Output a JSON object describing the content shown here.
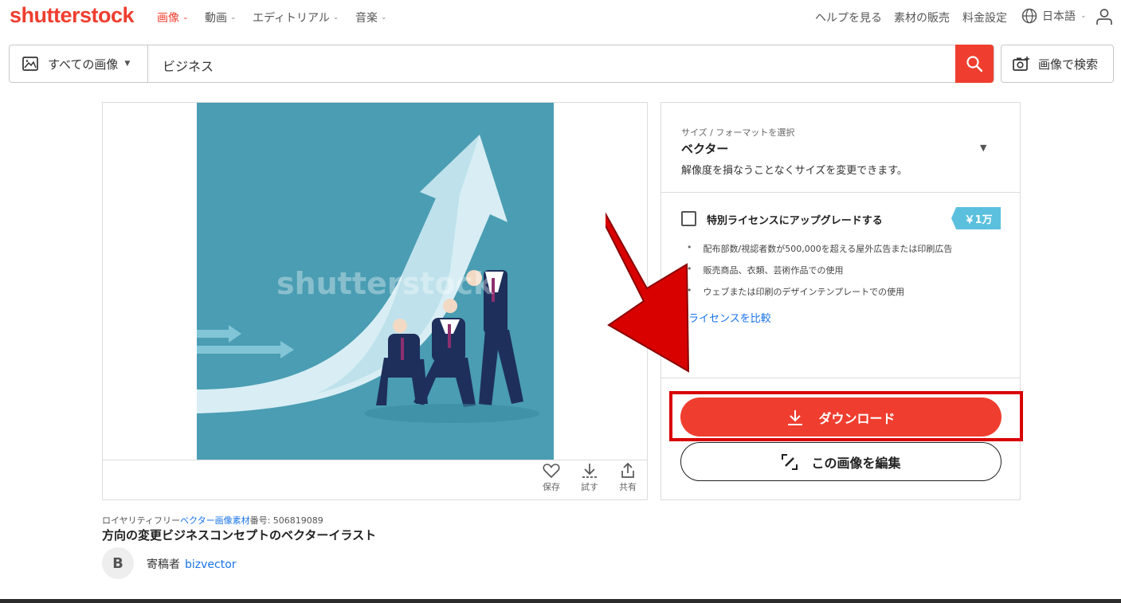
{
  "brand": {
    "logo_text": "shutterstock",
    "accent": "#ef3e2f"
  },
  "nav": {
    "items": [
      {
        "label": "画像",
        "active": true
      },
      {
        "label": "動画",
        "active": false
      },
      {
        "label": "エディトリアル",
        "active": false
      },
      {
        "label": "音楽",
        "active": false
      }
    ],
    "util": {
      "help": "ヘルプを見る",
      "sell": "素材の販売",
      "pricing": "料金設定",
      "language": "日本語"
    }
  },
  "search": {
    "scope": "すべての画像",
    "query": "ビジネス",
    "image_search": "画像で検索"
  },
  "image": {
    "watermark": "shutterstock",
    "actions": {
      "save": "保存",
      "try": "試す",
      "share": "共有"
    }
  },
  "license": {
    "size_label": "サイズ / フォーマットを選択",
    "size_value": "ベクター",
    "size_desc": "解像度を損なうことなくサイズを変更できます。",
    "upgrade_label": "特別ライセンスにアップグレードする",
    "price": "￥1万",
    "bullets": [
      "配布部数/視認者数が500,000を超える屋外広告または印刷広告",
      "販売商品、衣類、芸術作品での使用",
      "ウェブまたは印刷のデザインテンプレートでの使用"
    ],
    "compare": "ライセンスを比較",
    "download": "ダウンロード",
    "edit": "この画像を編集"
  },
  "meta": {
    "prefix": "ロイヤリティフリー",
    "link": "ベクター画像素材",
    "id_text": "番号: 506819089",
    "title": "方向の変更ビジネスコンセプトのベクターイラスト",
    "avatar_letter": "B",
    "contributor_label": "寄稿者",
    "contributor": "bizvector"
  },
  "colors": {
    "annotation_red": "#d90000",
    "artwork_bg": "#4a9db3"
  }
}
